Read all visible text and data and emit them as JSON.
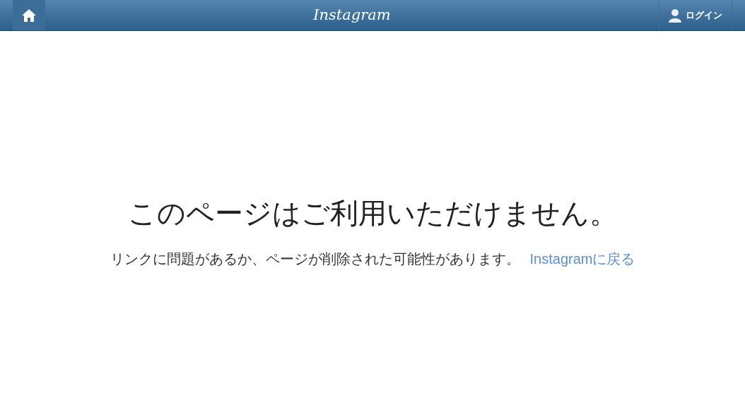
{
  "header": {
    "logo": "Instagram",
    "login_button": "ログイン"
  },
  "message": {
    "title": "このページはご利用いただけません。",
    "text": "リンクに問題があるか、ページが削除された可能性があります。",
    "link": "Instagramに戻る"
  }
}
